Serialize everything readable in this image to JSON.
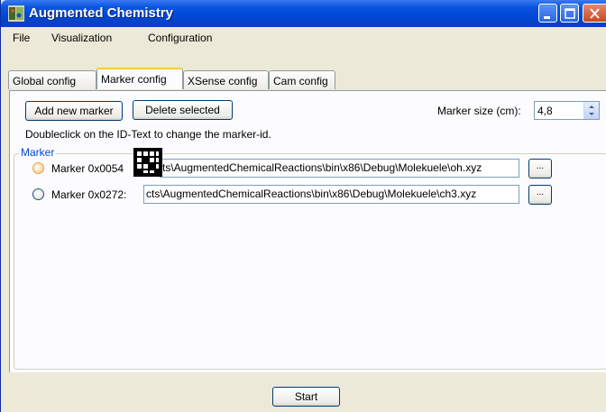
{
  "window": {
    "title": "Augmented Chemistry"
  },
  "menu": [
    "File",
    "Visualization",
    "Configuration"
  ],
  "tabs": [
    {
      "label": "Global config",
      "active": false
    },
    {
      "label": "Marker config",
      "active": true
    },
    {
      "label": "XSense config",
      "active": false
    },
    {
      "label": "Cam config",
      "active": false
    }
  ],
  "toolbar": {
    "add_label": "Add new marker",
    "delete_label": "Delete selected",
    "size_label": "Marker size (cm):",
    "size_value": "4,8"
  },
  "hint": "Doubleclick on the ID-Text to change the marker-id.",
  "group": {
    "legend": "Marker",
    "markers": [
      {
        "label": "Marker 0x0054",
        "path": "ts\\AugmentedChemicalReactions\\bin\\x86\\Debug\\Molekuele\\oh.xyz",
        "browse": "..."
      },
      {
        "label": "Marker 0x0272:",
        "path": "cts\\AugmentedChemicalReactions\\bin\\x86\\Debug\\Molekuele\\ch3.xyz",
        "browse": "..."
      }
    ]
  },
  "footer": {
    "start_label": "Start"
  },
  "colors": {
    "titlebar": "#0047d6",
    "active_tab_accent": "#ffc83c",
    "group_legend": "#0046d5"
  }
}
